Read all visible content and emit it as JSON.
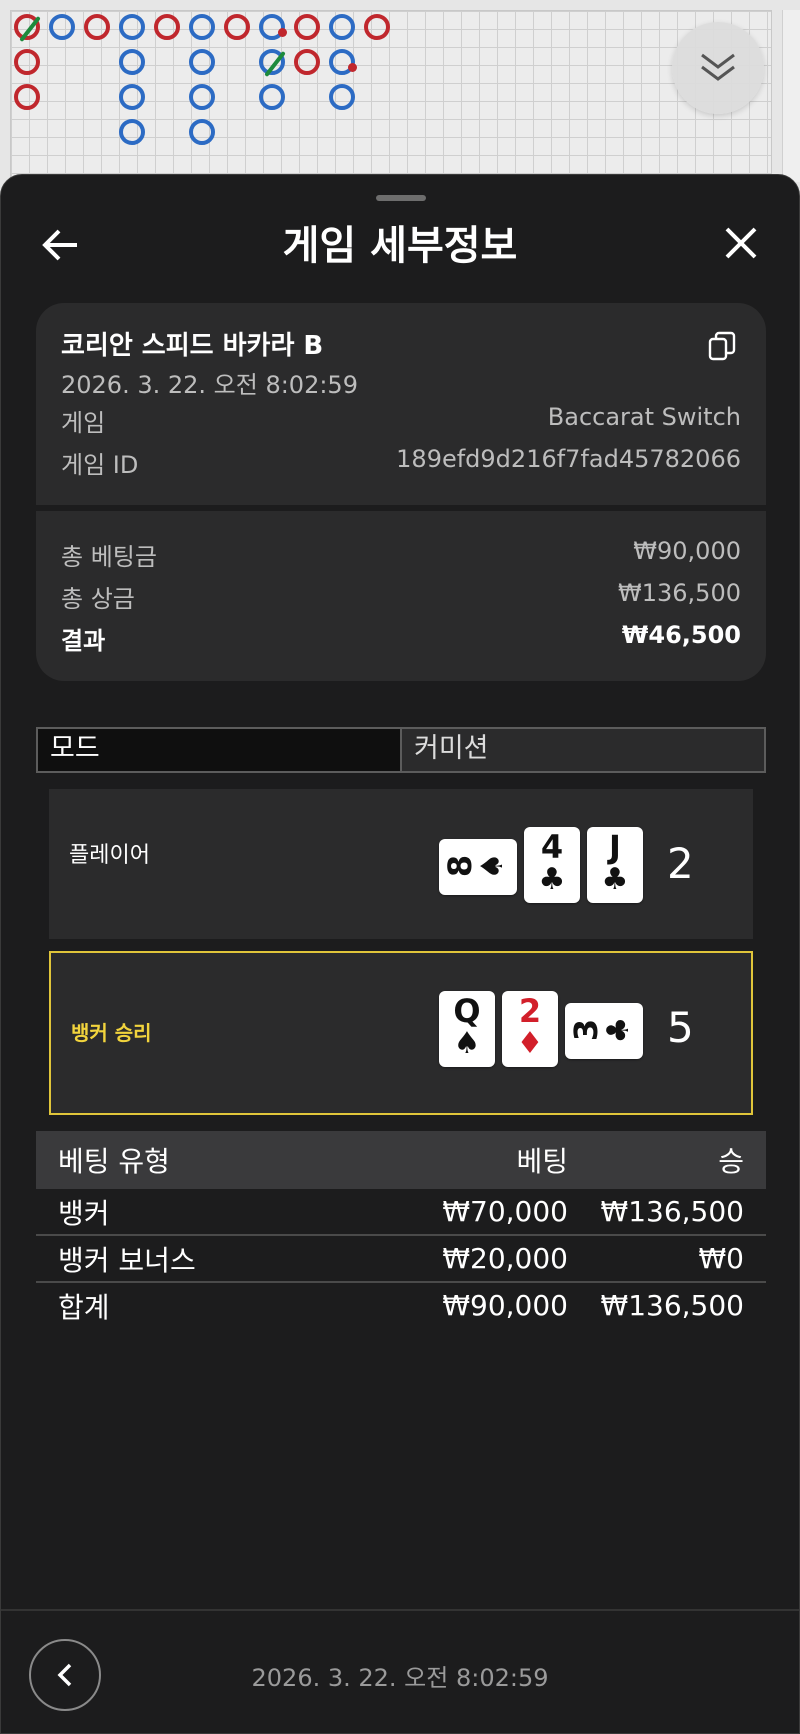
{
  "header": {
    "title": "게임 세부정보"
  },
  "summary": {
    "game_name": "코리안 스피드 바카라 B",
    "datetime": "2026. 3. 22. 오전 8:02:59",
    "game_label": "게임",
    "game_value": "Baccarat Switch",
    "game_id_label": "게임 ID",
    "game_id_value": "189efd9d216f7fad45782066",
    "total_bet_label": "총 베팅금",
    "total_bet_value": "₩90,000",
    "total_win_label": "총 상금",
    "total_win_value": "₩136,500",
    "result_label": "결과",
    "result_value": "₩46,500"
  },
  "tabs": {
    "mode": "모드",
    "commission": "커미션"
  },
  "hands": {
    "player": {
      "label": "플레이어",
      "score": "2",
      "cards": [
        {
          "rank": "8",
          "suit": "♠",
          "orientation": "horizontal",
          "color": "#111111"
        },
        {
          "rank": "4",
          "suit": "♣",
          "orientation": "vertical",
          "color": "#111111"
        },
        {
          "rank": "J",
          "suit": "♣",
          "orientation": "vertical",
          "color": "#111111"
        }
      ]
    },
    "banker": {
      "label": "뱅커 승리",
      "score": "5",
      "cards": [
        {
          "rank": "Q",
          "suit": "♠",
          "orientation": "vertical",
          "color": "#111111"
        },
        {
          "rank": "2",
          "suit": "♦",
          "orientation": "vertical",
          "color": "#d21f2a"
        },
        {
          "rank": "3",
          "suit": "♣",
          "orientation": "horizontal",
          "color": "#111111"
        }
      ]
    }
  },
  "bets_table": {
    "headers": [
      "베팅 유형",
      "베팅",
      "승"
    ],
    "rows": [
      [
        "뱅커",
        "₩70,000",
        "₩136,500"
      ],
      [
        "뱅커 보너스",
        "₩20,000",
        "₩0"
      ],
      [
        "합계",
        "₩90,000",
        "₩136,500"
      ]
    ]
  },
  "footer": {
    "datetime": "2026. 3. 22. 오전 8:02:59"
  },
  "roadmap": {
    "colors": {
      "banker": "#c0272d",
      "player": "#2c6bc4",
      "tie": "#1d8a3c"
    },
    "columns": [
      [
        "B-tie",
        "B",
        "B"
      ],
      [
        "P"
      ],
      [
        "B"
      ],
      [
        "P",
        "P",
        "P",
        "P"
      ],
      [
        "B"
      ],
      [
        "P",
        "P",
        "P",
        "P"
      ],
      [
        "B"
      ],
      [
        "P-banker-pair",
        "P-tie",
        "P"
      ],
      [
        "B",
        "B"
      ],
      [
        "P",
        "P-banker-pair",
        "P"
      ],
      [
        "B"
      ]
    ]
  },
  "icons": {
    "collapse": "double-chevron-down-icon",
    "back": "arrow-left-icon",
    "close": "close-icon",
    "copy": "copy-icon",
    "footer_back": "chevron-left-icon"
  }
}
